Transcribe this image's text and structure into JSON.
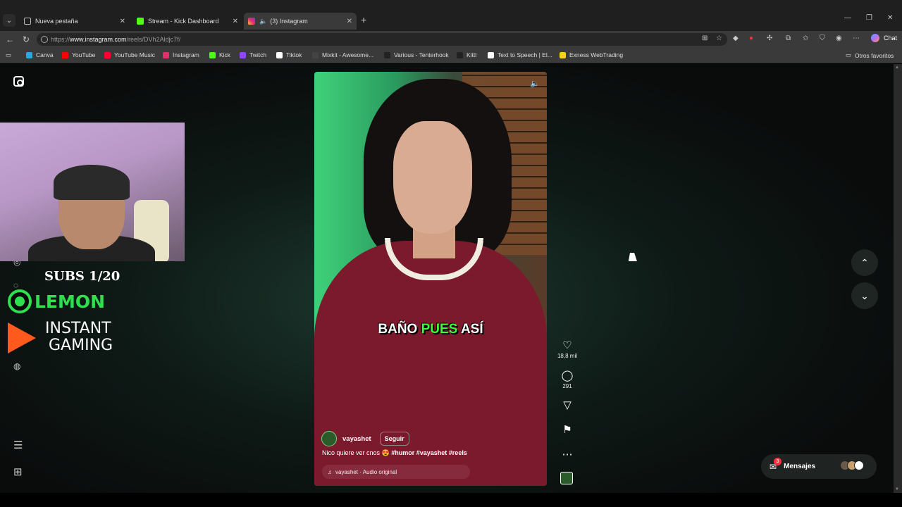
{
  "browser": {
    "tabs": [
      {
        "label": "Nueva pestaña",
        "icon": "new-tab-icon"
      },
      {
        "label": "Stream - Kick Dashboard",
        "icon": "kick-icon"
      },
      {
        "label": "(3) Instagram",
        "icon": "instagram-icon"
      }
    ],
    "url_prefix": "https://",
    "url_host": "www.instagram.com",
    "url_path": "/reels/DVh2Aldjc7f/",
    "chat_label": "Chat",
    "bookmarks": [
      {
        "label": "Canva",
        "color": "#2aa7e0"
      },
      {
        "label": "YouTube",
        "color": "#ff0000"
      },
      {
        "label": "YouTube Music",
        "color": "#ff0033"
      },
      {
        "label": "Instagram",
        "color": "#e1306c"
      },
      {
        "label": "Kick",
        "color": "#53fc18"
      },
      {
        "label": "Twitch",
        "color": "#9146ff"
      },
      {
        "label": "Tiktok",
        "color": "#ffffff"
      },
      {
        "label": "Mixkit - Awesome...",
        "color": "#444444"
      },
      {
        "label": "Various - Tenterhook",
        "color": "#222222"
      },
      {
        "label": "Kittl",
        "color": "#222222"
      },
      {
        "label": "Text to Speech | El...",
        "color": "#ffffff"
      },
      {
        "label": "Exness WebTrading",
        "color": "#f7d21c"
      }
    ],
    "other_bookmarks": "Otros favoritos"
  },
  "overlay": {
    "subs": "SUBS 1/20",
    "lemon": "LEMON",
    "instant": "INSTANT",
    "gaming": "GAMING"
  },
  "reel": {
    "caption_pre": "BAÑO",
    "caption_hl": "PUES",
    "caption_post": "ASÍ",
    "author": "vayashet",
    "follow": "Seguir",
    "description": "Nico quiere ver cnos 😍",
    "hashtags": "#humor #vayashet #reels",
    "audio": "vayashet · Audio original",
    "likes": "18,8 mil",
    "comments": "291"
  },
  "messages": {
    "label": "Mensajes",
    "badge": "3"
  }
}
